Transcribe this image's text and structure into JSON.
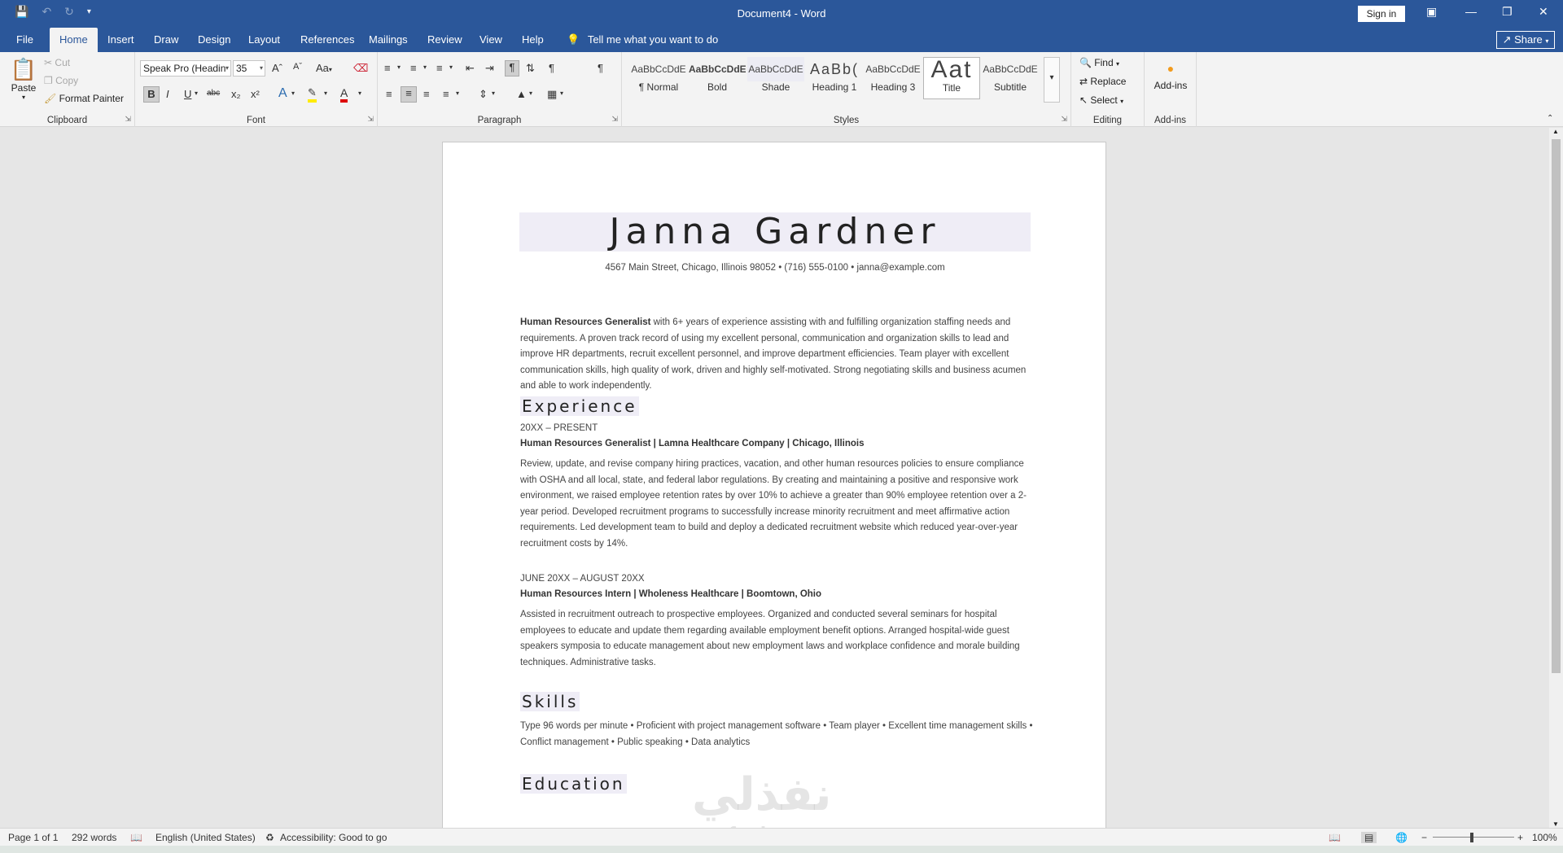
{
  "window": {
    "title": "Document4  -  Word",
    "sign_in": "Sign in"
  },
  "tabs": [
    "File",
    "Home",
    "Insert",
    "Draw",
    "Design",
    "Layout",
    "References",
    "Mailings",
    "Review",
    "View",
    "Help"
  ],
  "tell_me": "Tell me what you want to do",
  "share": "Share",
  "clipboard": {
    "paste": "Paste",
    "cut": "Cut",
    "copy": "Copy",
    "format_painter": "Format Painter",
    "label": "Clipboard"
  },
  "font": {
    "name": "Speak Pro (Headin",
    "size": "35",
    "label": "Font",
    "change_case": "Aa"
  },
  "paragraph": {
    "label": "Paragraph"
  },
  "styles": {
    "label": "Styles",
    "items": [
      {
        "sample": "AaBbCcDdE",
        "name": "¶ Normal"
      },
      {
        "sample": "AaBbCcDdE",
        "name": "Bold"
      },
      {
        "sample": "AaBbCcDdE",
        "name": "Shade"
      },
      {
        "sample": "AaBb(",
        "name": "Heading 1"
      },
      {
        "sample": "AaBbCcDdE",
        "name": "Heading 3"
      },
      {
        "sample": "Aat",
        "name": "Title"
      },
      {
        "sample": "AaBbCcDdE",
        "name": "Subtitle"
      }
    ]
  },
  "editing": {
    "find": "Find",
    "replace": "Replace",
    "select": "Select",
    "label": "Editing"
  },
  "addins": {
    "button": "Add-ins",
    "label": "Add-ins"
  },
  "document": {
    "name": "Janna Gardner",
    "contact": "4567 Main Street, Chicago, Illinois 98052 • (716) 555-0100 • janna@example.com",
    "summary_bold": "Human Resources Generalist",
    "summary_rest": " with 6+ years of experience assisting with and fulfilling organization staffing needs and requirements. A proven track record of using my excellent personal, communication and organization skills to lead and improve HR departments, recruit excellent personnel, and improve department efficiencies. Team player with excellent communication skills, high quality of work, driven and highly self-motivated. Strong negotiating skills and business acumen and able to work independently.",
    "experience_heading": "Experience",
    "job1_date": "20XX – PRESENT",
    "job1_title": "Human Resources Generalist | Lamna Healthcare Company | Chicago, Illinois",
    "job1_desc": "Review, update, and revise company hiring practices, vacation, and other human resources policies to ensure compliance with OSHA and all local, state, and federal labor regulations. By creating and maintaining a positive and responsive work environment, we raised employee retention rates by over 10% to achieve a greater than 90% employee retention over a 2-year period. Developed recruitment programs to successfully increase minority recruitment and meet affirmative action requirements. Led development team to build and deploy a dedicated recruitment website which reduced year-over-year recruitment costs by 14%.",
    "job2_date": "JUNE 20XX – AUGUST 20XX",
    "job2_title": "Human Resources Intern | Wholeness Healthcare | Boomtown, Ohio",
    "job2_desc": "Assisted in recruitment outreach to prospective employees. Organized and conducted several seminars for hospital employees to educate and update them regarding available employment benefit options. Arranged hospital-wide guest speakers symposia to educate management about new employment laws and workplace confidence and morale building techniques. Administrative tasks.",
    "skills_heading": "Skills",
    "skills_text": "Type 96 words per minute • Proficient with project management software • Team player • Excellent time management skills • Conflict management • Public speaking • Data analytics",
    "education_heading": "Education"
  },
  "status": {
    "page": "Page 1 of 1",
    "words": "292 words",
    "language": "English (United States)",
    "accessibility": "Accessibility: Good to go",
    "zoom": "100%"
  },
  "watermark": {
    "arabic": "نفذلي",
    "latin": "nafezly.com"
  }
}
